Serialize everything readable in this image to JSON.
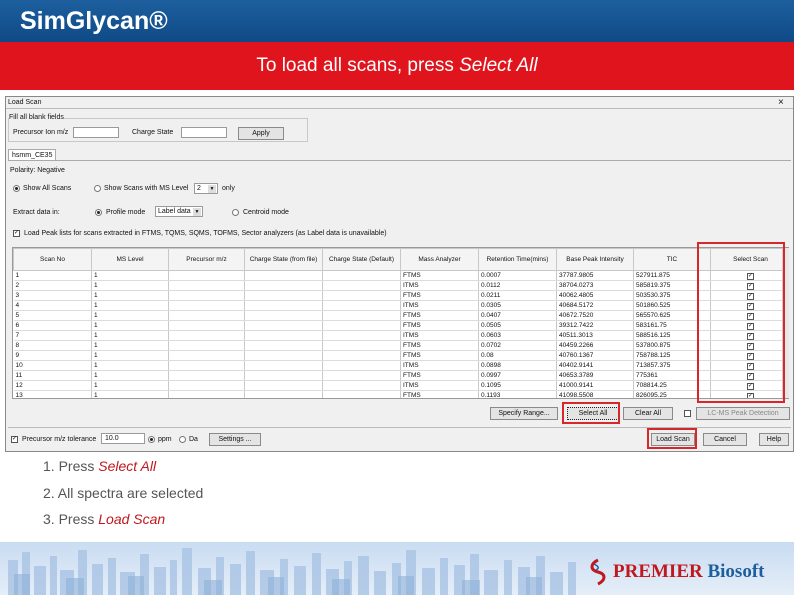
{
  "header": {
    "brand": "SimGlycan®"
  },
  "banner": {
    "prefix": "To load all scans, press ",
    "emph": "Select All"
  },
  "window": {
    "title": "Load Scan",
    "close": "×",
    "fill_group": "Fill all blank fields",
    "precursor_label": "Precursor Ion m/z",
    "precursor_value": "",
    "charge_label": "Charge State",
    "charge_value": "",
    "apply": "Apply",
    "file_tab": "hsmm_CE35",
    "polarity": "Polarity: Negative",
    "show_all": "Show All Scans",
    "show_ms": "Show Scans with MS Level",
    "ms_level": "2",
    "only": "only",
    "extract_label": "Extract data in:",
    "profile_mode": "Profile mode",
    "profile_select": "Label data",
    "centroid_mode": "Centroid mode",
    "load_peak_list": "Load Peak lists for scans extracted in FTMS, TQMS, SQMS, TOFMS, Sector analyzers (as Label data is unavailable)",
    "columns": [
      "Scan No",
      "MS Level",
      "Precursor m/z",
      "Charge State (from file)",
      "Charge State (Default)",
      "Mass Analyzer",
      "Retention Time(mins)",
      "Base Peak Intensity",
      "TIC",
      "Select Scan"
    ],
    "rows": [
      [
        "1",
        "1",
        "",
        "",
        "",
        "FTMS",
        "0.0007",
        "37787.9805",
        "527911.875"
      ],
      [
        "2",
        "1",
        "",
        "",
        "",
        "ITMS",
        "0.0112",
        "38704.0273",
        "585819.375"
      ],
      [
        "3",
        "1",
        "",
        "",
        "",
        "FTMS",
        "0.0211",
        "40062.4805",
        "503530.375"
      ],
      [
        "4",
        "1",
        "",
        "",
        "",
        "ITMS",
        "0.0305",
        "40684.5172",
        "501860.525"
      ],
      [
        "5",
        "1",
        "",
        "",
        "",
        "FTMS",
        "0.0407",
        "40672.7520",
        "565570.625"
      ],
      [
        "6",
        "1",
        "",
        "",
        "",
        "FTMS",
        "0.0505",
        "39312.7422",
        "583161.75"
      ],
      [
        "7",
        "1",
        "",
        "",
        "",
        "ITMS",
        "0.0603",
        "40511.3013",
        "588516.125"
      ],
      [
        "8",
        "1",
        "",
        "",
        "",
        "FTMS",
        "0.0702",
        "40459.2266",
        "537800.875"
      ],
      [
        "9",
        "1",
        "",
        "",
        "",
        "FTMS",
        "0.08",
        "40760.1367",
        "758788.125"
      ],
      [
        "10",
        "1",
        "",
        "",
        "",
        "ITMS",
        "0.0898",
        "40402.9141",
        "713857.375"
      ],
      [
        "11",
        "1",
        "",
        "",
        "",
        "FTMS",
        "0.0997",
        "40653.3789",
        "775361"
      ],
      [
        "12",
        "1",
        "",
        "",
        "",
        "ITMS",
        "0.1095",
        "41000.9141",
        "708814.25"
      ],
      [
        "13",
        "1",
        "",
        "",
        "",
        "FTMS",
        "0.1193",
        "41098.5508",
        "826095.25"
      ]
    ],
    "specify_range": "Specify Range...",
    "select_all": "Select All",
    "clear_all": "Clear All",
    "lcms": "LC-MS Peak Detection",
    "precursor_tol_label": "Precursor m/z tolerance",
    "tol_value": "10.0",
    "ppm": "ppm",
    "da": "Da",
    "settings": "Settings ...",
    "load_scan": "Load Scan",
    "cancel": "Cancel",
    "help": "Help"
  },
  "steps": [
    {
      "num": "1. Press ",
      "emph": "Select All"
    },
    {
      "num": "2. All spectra are selected",
      "emph": ""
    },
    {
      "num": "3. Press ",
      "emph": "Load Scan"
    }
  ],
  "footer": {
    "logo_word1": "PREMIER",
    "logo_word2": " Biosoft"
  },
  "colors": {
    "header_blue": "#1d5f9e",
    "banner_red": "#e0141c",
    "highlight_red": "#d9262b",
    "step_red": "#c0181e"
  }
}
